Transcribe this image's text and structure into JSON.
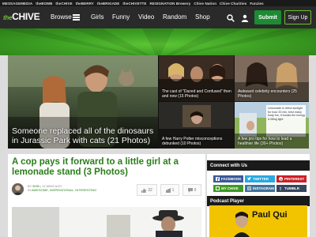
{
  "network": [
    "MESSAGEMEDIA",
    "theBOMB",
    "theCHIVE",
    "theBERRY",
    "theBRIGADE",
    "theCHIVETTE",
    "RESIGNATION Brewery",
    "Chive Nation",
    "Chive Charities",
    "Funzies"
  ],
  "header": {
    "logo_the": "the",
    "logo_chive": "CHIVE",
    "nav": [
      "Browse",
      "Girls",
      "Funny",
      "Video",
      "Random",
      "Shop"
    ],
    "submit_label": "Submit",
    "signup_label": "Sign Up"
  },
  "hero": {
    "main_caption": "Someone replaced all of the dinosaurs in Jurassic Park with cats (21 Photos)",
    "tiles": [
      "The cast of \"Dazed and Confused\" then and now (15 Photos)",
      "Awkward celebrity encounters (25 Photos)",
      "A few Harry Potter misconceptions debunked (10 Photos)",
      "A few pro tips for how to lead a healthier life (30+ Photos)"
    ],
    "sign_text": "Lemonade in direct sunlight for hour 20 min, best many body fun, it boosts the energy & lifting light"
  },
  "article": {
    "headline": "A cop pays it forward to a little girl at a lemonade stand (3 Photos)",
    "byline_by": "BY",
    "byline_author": "BOB",
    "byline_time": "14 MINS AGO",
    "byline_in": "IN",
    "byline_tags": "AWESOME, INSPIRATIONAL, INTERESTING",
    "likes": "32",
    "shares": "1",
    "comments": "0"
  },
  "sidebar": {
    "connect_title": "Connect with Us",
    "socials": [
      {
        "label": "FACEBOOK",
        "color": "#3b5998"
      },
      {
        "label": "TWITTER",
        "color": "#29a9e0"
      },
      {
        "label": "PINTEREST",
        "color": "#cb2027"
      },
      {
        "label": "MY CHIVE",
        "color": "#3e9a24"
      },
      {
        "label": "INSTAGRAM",
        "color": "#3f729b"
      },
      {
        "label": "TUMBLR",
        "color": "#35465c"
      }
    ],
    "podcast_title": "Podcast Player",
    "podcast_name": "Paul Qui"
  }
}
